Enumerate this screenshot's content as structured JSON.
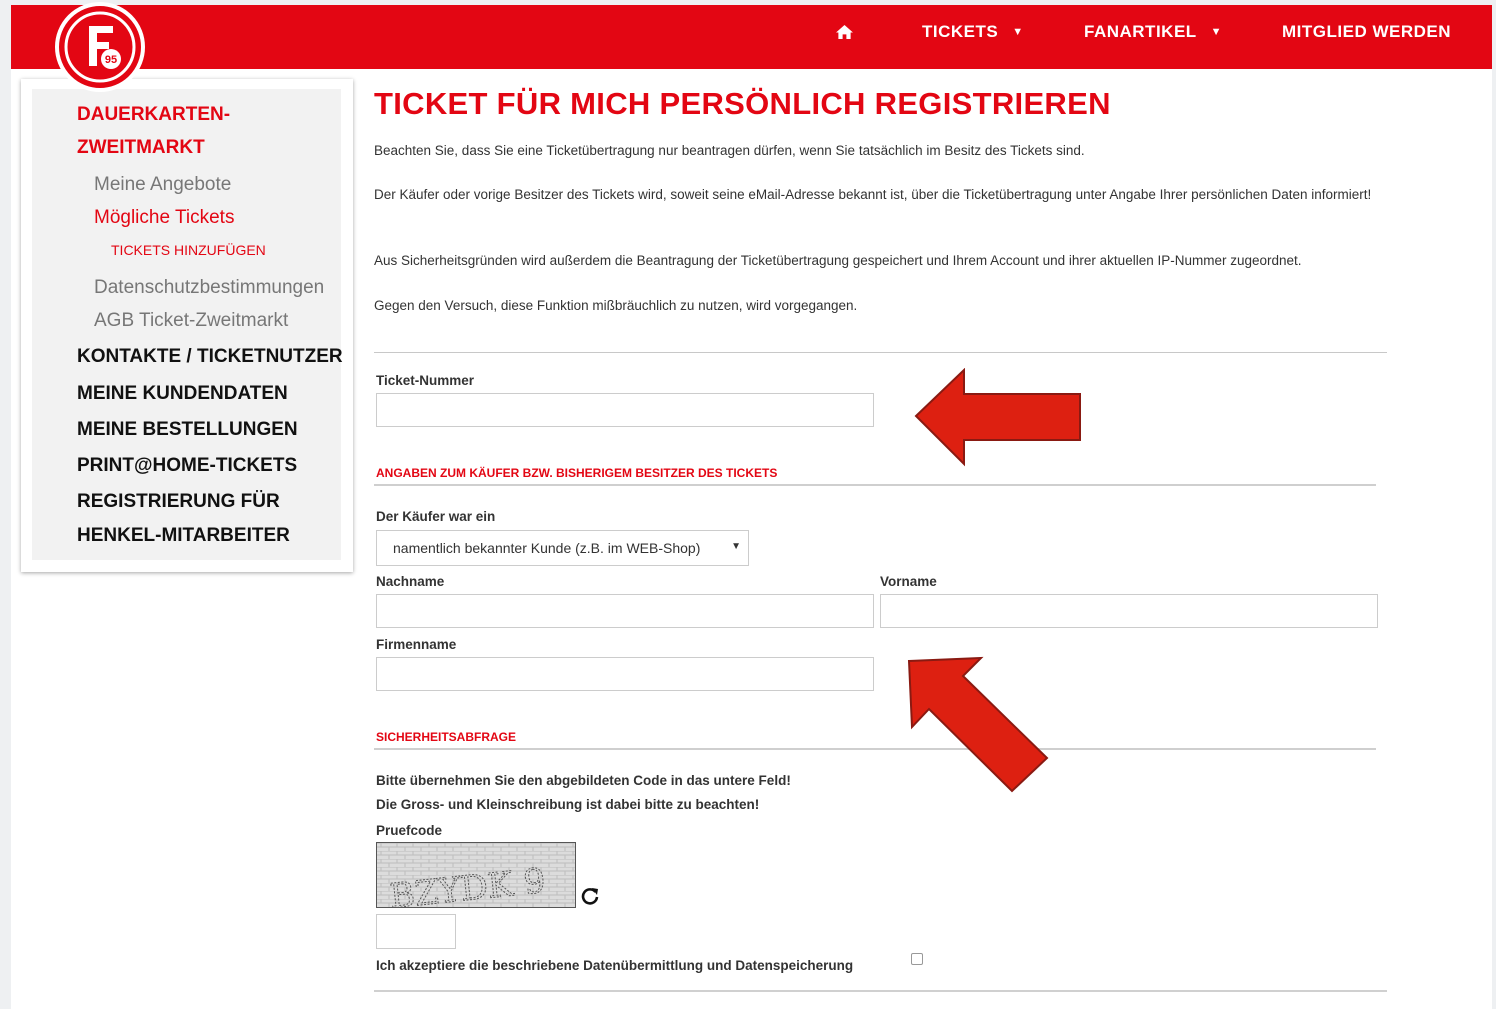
{
  "nav": {
    "home_icon": "home-icon",
    "tickets": "TICKETS",
    "fanartikel": "FANARTIKEL",
    "mitglied": "MITGLIED WERDEN",
    "dropdown_icon": "caret-down-icon"
  },
  "logo": {
    "text": "95",
    "letter": "F"
  },
  "sidebar": {
    "section_head_line1": "DAUERKARTEN-",
    "section_head_line2": "ZWEITMARKT",
    "items": [
      {
        "label": "Meine Angebote"
      },
      {
        "label": "Mögliche Tickets"
      },
      {
        "label": "TICKETS HINZUFÜGEN"
      },
      {
        "label": "Datenschutzbestimmungen"
      },
      {
        "label": "AGB Ticket-Zweitmarkt"
      }
    ],
    "main_items": [
      {
        "label": "KONTAKTE / TICKETNUTZER"
      },
      {
        "label": "MEINE KUNDENDATEN"
      },
      {
        "label": "MEINE BESTELLUNGEN"
      },
      {
        "label": "PRINT@HOME-TICKETS"
      },
      {
        "label_line1": "REGISTRIERUNG FÜR",
        "label_line2": "HENKEL-MITARBEITER"
      }
    ]
  },
  "main": {
    "title": "TICKET FÜR MICH PERSÖNLICH REGISTRIEREN",
    "paragraphs": [
      "Beachten Sie, dass Sie eine Ticketübertragung nur beantragen dürfen, wenn Sie tatsächlich im Besitz des Tickets sind.",
      "Der Käufer oder vorige Besitzer des Tickets wird, soweit seine eMail-Adresse bekannt ist, über die Ticketübertragung unter Angabe Ihrer persönlichen Daten informiert!",
      "Aus Sicherheitsgründen wird außerdem die Beantragung der Ticketübertragung gespeichert und Ihrem Account und ihrer aktuellen IP-Nummer zugeordnet.",
      "Gegen den Versuch, diese Funktion mißbräuchlich zu nutzen, wird vorgegangen."
    ]
  },
  "form": {
    "ticket_number_label": "Ticket-Nummer",
    "ticket_number_value": "",
    "buyer_section": "ANGABEN ZUM KÄUFER BZW. BISHERIGEM BESITZER DES TICKETS",
    "buyer_type_label": "Der Käufer war ein",
    "buyer_type_value": "namentlich bekannter Kunde (z.B. im WEB-Shop)",
    "lastname_label": "Nachname",
    "lastname_value": "",
    "firstname_label": "Vorname",
    "firstname_value": "",
    "company_label": "Firmenname",
    "company_value": "",
    "security_section": "SICHERHEITSABFRAGE",
    "captcha_hint_1": "Bitte übernehmen Sie den abgebildeten Code in das untere Feld!",
    "captcha_hint_2": "Die Gross- und Kleinschreibung ist dabei bitte zu beachten!",
    "captcha_label": "Pruefcode",
    "captcha_text": "BZYDK 9",
    "captcha_value": "",
    "consent_label": "Ich akzeptiere die beschriebene Datenübermittlung und Datenspeicherung",
    "consent_checked": false
  },
  "colors": {
    "brand_red": "#e30613",
    "annotation_arrow": "#dd2011"
  }
}
